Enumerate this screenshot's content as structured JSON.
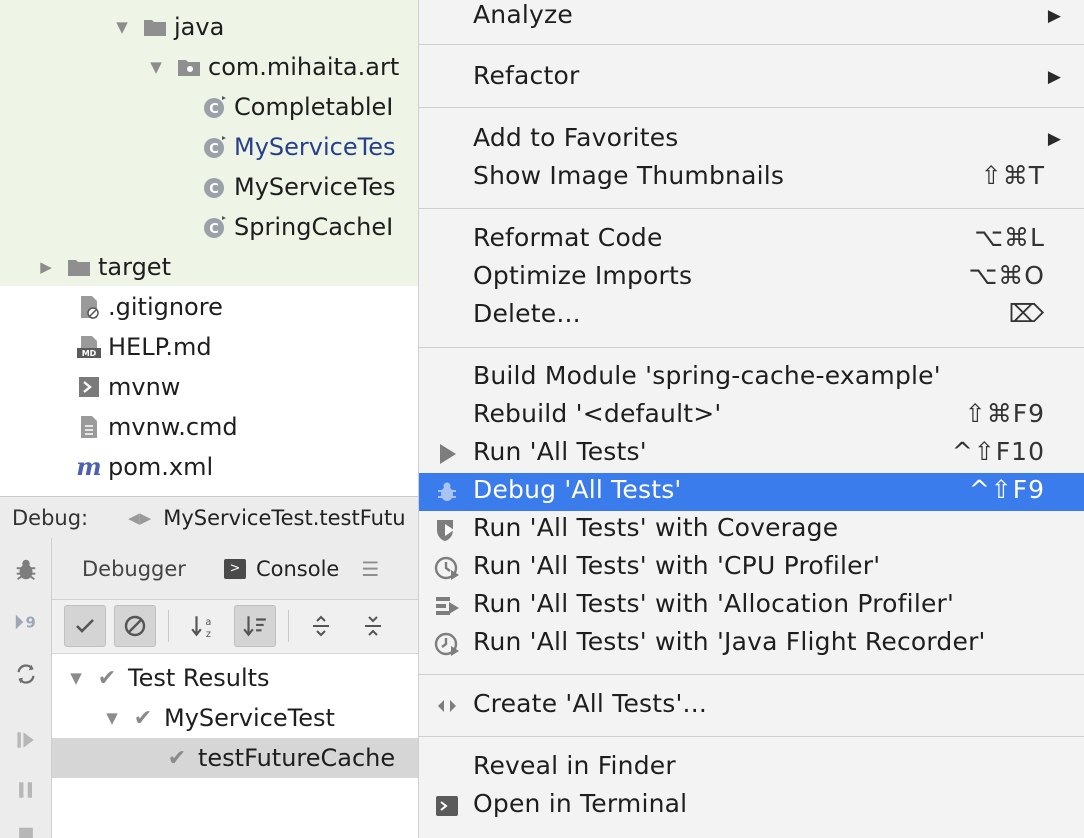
{
  "project_tree": {
    "items": [
      {
        "label": "java",
        "icon": "folder-icon",
        "arrow": "▼"
      },
      {
        "label": "com.mihaita.art",
        "icon": "package-icon",
        "arrow": "▼"
      },
      {
        "label": "CompletableI",
        "icon": "test-class-icon",
        "arrow": ""
      },
      {
        "label": "MyServiceTes",
        "icon": "test-class-icon",
        "arrow": ""
      },
      {
        "label": "MyServiceTes",
        "icon": "class-icon",
        "arrow": ""
      },
      {
        "label": "SpringCacheI",
        "icon": "test-class-icon",
        "arrow": ""
      },
      {
        "label": "target",
        "icon": "folder-icon",
        "arrow": "▶"
      },
      {
        "label": ".gitignore",
        "icon": "ignored-file-icon",
        "arrow": ""
      },
      {
        "label": "HELP.md",
        "icon": "markdown-icon",
        "arrow": ""
      },
      {
        "label": "mvnw",
        "icon": "shell-script-icon",
        "arrow": ""
      },
      {
        "label": "mvnw.cmd",
        "icon": "text-file-icon",
        "arrow": ""
      },
      {
        "label": "pom.xml",
        "icon": "maven-icon",
        "arrow": ""
      }
    ]
  },
  "debug_panel": {
    "label": "Debug:",
    "session_tab": "MyServiceTest.testFutu",
    "tabs": {
      "debugger": "Debugger",
      "console": "Console"
    },
    "results": [
      {
        "label": "Test Results",
        "arrow": "▼"
      },
      {
        "label": "MyServiceTest",
        "arrow": "▼"
      },
      {
        "label": "testFutureCache",
        "arrow": ""
      }
    ]
  },
  "context_menu": {
    "items": [
      {
        "label": "Analyze",
        "shortcut": "",
        "submenu": true,
        "icon": ""
      },
      {
        "label": "Refactor",
        "shortcut": "",
        "submenu": true,
        "icon": ""
      },
      {
        "label": "Add to Favorites",
        "shortcut": "",
        "submenu": true,
        "icon": ""
      },
      {
        "label": "Show Image Thumbnails",
        "shortcut": "⇧⌘T",
        "submenu": false,
        "icon": ""
      },
      {
        "label": "Reformat Code",
        "shortcut": "⌥⌘L",
        "submenu": false,
        "icon": ""
      },
      {
        "label": "Optimize Imports",
        "shortcut": "⌥⌘O",
        "submenu": false,
        "icon": ""
      },
      {
        "label": "Delete...",
        "shortcut": "⌦",
        "submenu": false,
        "icon": ""
      },
      {
        "label": "Build Module 'spring-cache-example'",
        "shortcut": "",
        "submenu": false,
        "icon": ""
      },
      {
        "label": "Rebuild '<default>'",
        "shortcut": "⇧⌘F9",
        "submenu": false,
        "icon": ""
      },
      {
        "label": "Run 'All Tests'",
        "shortcut": "^⇧F10",
        "submenu": false,
        "icon": "run-icon"
      },
      {
        "label": "Debug 'All Tests'",
        "shortcut": "^⇧F9",
        "submenu": false,
        "icon": "debug-icon",
        "active": true
      },
      {
        "label": "Run 'All Tests' with Coverage",
        "shortcut": "",
        "submenu": false,
        "icon": "coverage-icon"
      },
      {
        "label": "Run 'All Tests' with 'CPU Profiler'",
        "shortcut": "",
        "submenu": false,
        "icon": "cpu-profiler-icon"
      },
      {
        "label": "Run 'All Tests' with 'Allocation Profiler'",
        "shortcut": "",
        "submenu": false,
        "icon": "allocation-profiler-icon"
      },
      {
        "label": "Run 'All Tests' with 'Java Flight Recorder'",
        "shortcut": "",
        "submenu": false,
        "icon": "flight-recorder-icon"
      },
      {
        "label": "Create 'All Tests'...",
        "shortcut": "",
        "submenu": false,
        "icon": "create-config-icon"
      },
      {
        "label": "Reveal in Finder",
        "shortcut": "",
        "submenu": false,
        "icon": ""
      },
      {
        "label": "Open in Terminal",
        "shortcut": "",
        "submenu": false,
        "icon": "terminal-icon"
      }
    ]
  },
  "colors": {
    "selection": "#3b7ced",
    "menu_bg": "#f3f3f3",
    "tree_highlight": "#eef4e6"
  }
}
